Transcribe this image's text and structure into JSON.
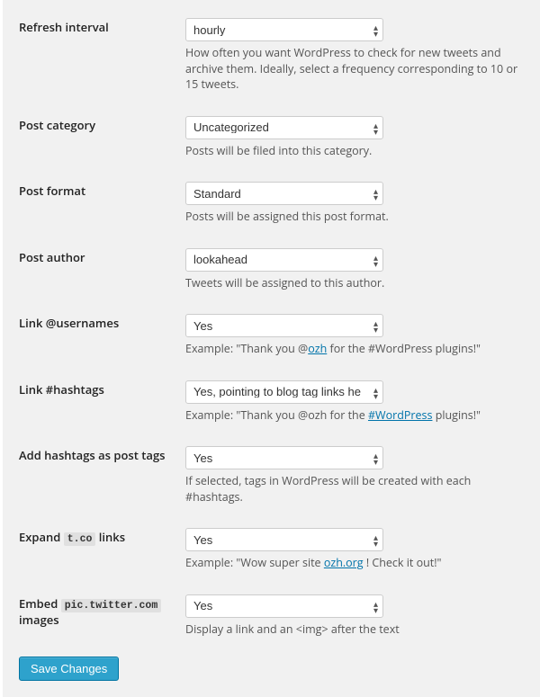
{
  "rows": {
    "refresh_interval": {
      "label": "Refresh interval",
      "value": "hourly",
      "description": "How often you want WordPress to check for new tweets and archive them. Ideally, select a frequency corresponding to 10 or 15 tweets."
    },
    "post_category": {
      "label": "Post category",
      "value": "Uncategorized",
      "description": "Posts will be filed into this category."
    },
    "post_format": {
      "label": "Post format",
      "value": "Standard",
      "description": "Posts will be assigned this post format."
    },
    "post_author": {
      "label": "Post author",
      "value": "lookahead",
      "description": "Tweets will be assigned to this author."
    },
    "link_usernames": {
      "label": "Link @usernames",
      "value": "Yes",
      "example_prefix": "Example: \"Thank you @",
      "example_link": "ozh",
      "example_suffix": " for the #WordPress plugins!\""
    },
    "link_hashtags": {
      "label": "Link #hashtags",
      "value": "Yes, pointing to blog tag links here",
      "example_prefix": "Example: \"Thank you @ozh for the ",
      "example_link": "#WordPress",
      "example_suffix": " plugins!\""
    },
    "add_hashtags_as_post_tags": {
      "label": "Add hashtags as post tags",
      "value": "Yes",
      "description": "If selected, tags in WordPress will be created with each #hashtags."
    },
    "expand_tco": {
      "label_pre": "Expand ",
      "label_code": "t.co",
      "label_post": " links",
      "value": "Yes",
      "example_prefix": "Example: \"Wow super site ",
      "example_link": "ozh.org",
      "example_suffix": " ! Check it out!\""
    },
    "embed_pic": {
      "label_pre": "Embed ",
      "label_code": "pic.twitter.com",
      "label_post": " images",
      "value": "Yes",
      "description": "Display a link and an <img> after the text"
    }
  },
  "submit_label": "Save Changes"
}
